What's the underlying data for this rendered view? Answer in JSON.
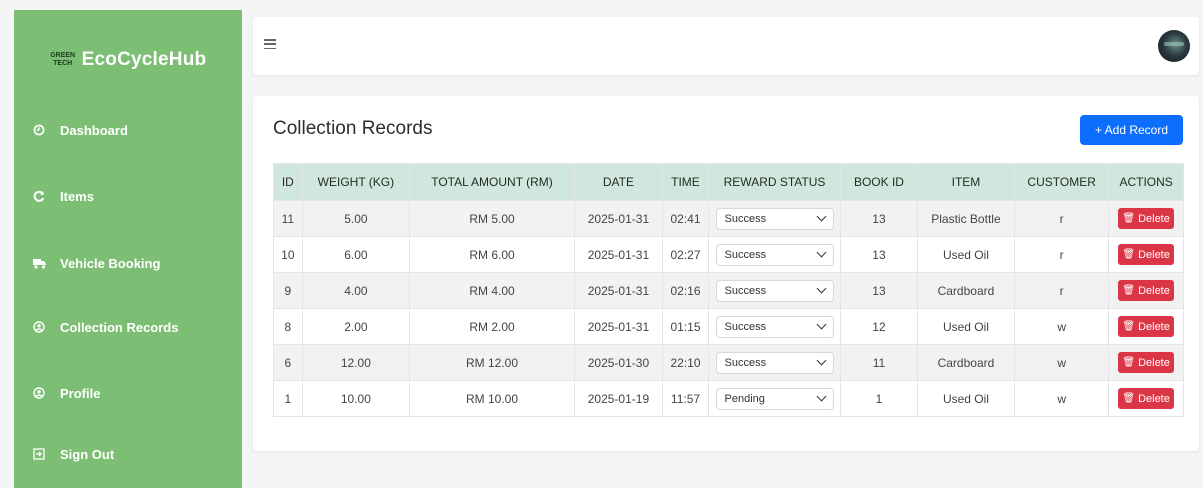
{
  "sidebar": {
    "brand_logo_top": "GREEN",
    "brand_logo_bottom": "TECH",
    "brand_name": "EcoCycleHub",
    "items": [
      {
        "label": "Dashboard",
        "icon": "dashboard-icon"
      },
      {
        "label": "Items",
        "icon": "recycle-icon"
      },
      {
        "label": "Vehicle Booking",
        "icon": "truck-icon"
      },
      {
        "label": "Collection Records",
        "icon": "user-circle-icon"
      },
      {
        "label": "Profile",
        "icon": "user-circle-icon"
      },
      {
        "label": "Sign Out",
        "icon": "sign-out-icon"
      }
    ]
  },
  "main": {
    "title": "Collection Records",
    "add_button": "+ Add Record",
    "columns": [
      "ID",
      "WEIGHT (KG)",
      "TOTAL AMOUNT (RM)",
      "DATE",
      "TIME",
      "REWARD STATUS",
      "BOOK ID",
      "ITEM",
      "CUSTOMER",
      "ACTIONS"
    ],
    "delete_label": "Delete",
    "rows": [
      {
        "id": "11",
        "weight": "5.00",
        "amount": "RM 5.00",
        "date": "2025-01-31",
        "time": "02:41",
        "status": "Success",
        "book_id": "13",
        "item": "Plastic Bottle",
        "customer": "r"
      },
      {
        "id": "10",
        "weight": "6.00",
        "amount": "RM 6.00",
        "date": "2025-01-31",
        "time": "02:27",
        "status": "Success",
        "book_id": "13",
        "item": "Used Oil",
        "customer": "r"
      },
      {
        "id": "9",
        "weight": "4.00",
        "amount": "RM 4.00",
        "date": "2025-01-31",
        "time": "02:16",
        "status": "Success",
        "book_id": "13",
        "item": "Cardboard",
        "customer": "r"
      },
      {
        "id": "8",
        "weight": "2.00",
        "amount": "RM 2.00",
        "date": "2025-01-31",
        "time": "01:15",
        "status": "Success",
        "book_id": "12",
        "item": "Used Oil",
        "customer": "w"
      },
      {
        "id": "6",
        "weight": "12.00",
        "amount": "RM 12.00",
        "date": "2025-01-30",
        "time": "22:10",
        "status": "Success",
        "book_id": "11",
        "item": "Cardboard",
        "customer": "w"
      },
      {
        "id": "1",
        "weight": "10.00",
        "amount": "RM 10.00",
        "date": "2025-01-19",
        "time": "11:57",
        "status": "Pending",
        "book_id": "1",
        "item": "Used Oil",
        "customer": "w"
      }
    ]
  },
  "colors": {
    "sidebar": "#7cbf74",
    "table_header": "#d1e7dd",
    "primary": "#0d6efd",
    "danger": "#dc3545"
  }
}
